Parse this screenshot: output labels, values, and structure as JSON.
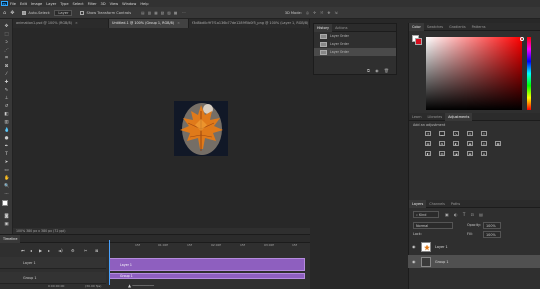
{
  "menubar": {
    "logo": "Ps",
    "items": [
      "File",
      "Edit",
      "Image",
      "Layer",
      "Type",
      "Select",
      "Filter",
      "3D",
      "View",
      "Window",
      "Help"
    ]
  },
  "options": {
    "auto_select_label": "Auto-Select:",
    "layer_select": "Layer",
    "transform_label": "Show Transform Controls",
    "mode_label": "3D Mode:"
  },
  "tabs": [
    {
      "label": "animation1.psd @ 100% (RGB/8)",
      "active": false
    },
    {
      "label": "Untitled-1 @ 100% (Group 1, RGB/8)",
      "active": true
    },
    {
      "label": "f3d8bd0c9f7f1a136b77de1289f5b0f5_png @ 100% (Layer 1, RGB/8)",
      "active": false
    }
  ],
  "status": "100%   380 px x 380 px (72 ppi)",
  "history": {
    "tabs": [
      "History",
      "Actions"
    ],
    "rows": [
      "Layer Order",
      "Layer Order",
      "Layer Order"
    ]
  },
  "right": {
    "color_tabs": [
      "Color",
      "Swatches",
      "Gradients",
      "Patterns"
    ],
    "colors": {
      "fg": "#ffffff",
      "bg": "#d70e1e",
      "picker_hue": "#ff0000"
    },
    "adj_tabs": [
      "Learn",
      "Libraries",
      "Adjustments"
    ],
    "adj_label": "Add an adjustment",
    "layers_tabs": [
      "Layers",
      "Channels",
      "Paths"
    ],
    "kind": "Kind",
    "blend": "Normal",
    "opacity_label": "Opacity:",
    "opacity": "100%",
    "lock_label": "Lock:",
    "fill_label": "Fill:",
    "fill": "100%",
    "layers": [
      {
        "name": "Layer 1",
        "selected": false
      },
      {
        "name": "Group 1",
        "selected": true
      }
    ]
  },
  "timeline": {
    "title": "Timeline",
    "ruler": [
      "15f",
      "01:00f",
      "15f",
      "02:00f",
      "15f",
      "03:00f",
      "15f"
    ],
    "tracks": [
      "Layer 1",
      "Group 1"
    ],
    "timecode": "0:00:00:00",
    "fps": "(30.00 fps)"
  }
}
